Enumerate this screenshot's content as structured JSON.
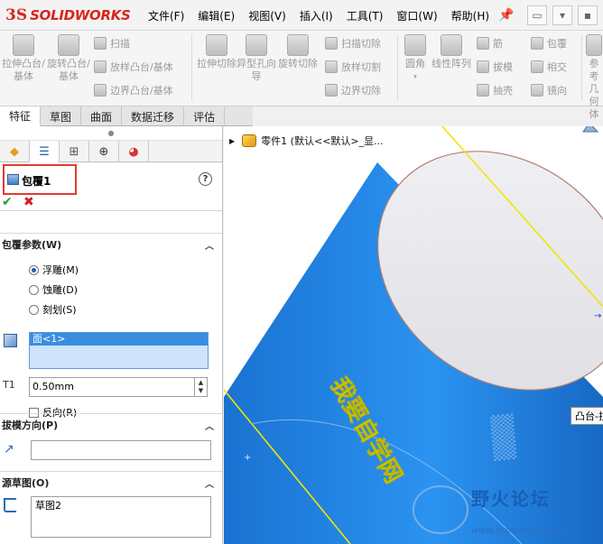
{
  "app": {
    "logo_ds": "3S",
    "logo_name": "SOLIDWORKS"
  },
  "menus": [
    "文件(F)",
    "编辑(E)",
    "视图(V)",
    "插入(I)",
    "工具(T)",
    "窗口(W)",
    "帮助(H)"
  ],
  "ribbon": {
    "big": [
      {
        "label": "拉伸凸台/基体"
      },
      {
        "label": "旋转凸台/基体"
      },
      {
        "label": "拉伸切除"
      },
      {
        "label": "异型孔向导"
      },
      {
        "label": "旋转切除"
      },
      {
        "label": "圆角"
      },
      {
        "label": "线性阵列"
      },
      {
        "label": "参考几何体"
      }
    ],
    "small_left": [
      "扫描",
      "放样凸台/基体",
      "边界凸台/基体"
    ],
    "small_mid": [
      "扫描切除",
      "放样切割",
      "边界切除"
    ],
    "small_right1": [
      "筋",
      "拔模",
      "抽壳"
    ],
    "small_right2": [
      "包覆",
      "相交",
      "镜向"
    ]
  },
  "command_tabs": [
    "特征",
    "草图",
    "曲面",
    "数据迁移",
    "评估"
  ],
  "property_manager": {
    "title": "包覆1",
    "help": "?",
    "ok": "✔",
    "cancel": "✖",
    "params_title": "包覆参数(W)",
    "radios": [
      {
        "label": "浮雕(M)",
        "checked": true
      },
      {
        "label": "蚀雕(D)",
        "checked": false
      },
      {
        "label": "刻划(S)",
        "checked": false
      }
    ],
    "face_selection": "面<1>",
    "thickness_icon": "T1",
    "thickness": "0.50mm",
    "reverse_label": "反向(R)",
    "draft_title": "拔模方向(P)",
    "source_title": "源草图(O)",
    "source_sketch": "草图2"
  },
  "viewport": {
    "tree_item": "零件1 (默认<<默认>_显...",
    "embossed_text": "我要自学网",
    "tooltip": "凸台-拉",
    "watermark_title": "野火论坛",
    "watermark_url": "www.proewildfire.cn",
    "cylinder_color": "#1f86e5"
  }
}
